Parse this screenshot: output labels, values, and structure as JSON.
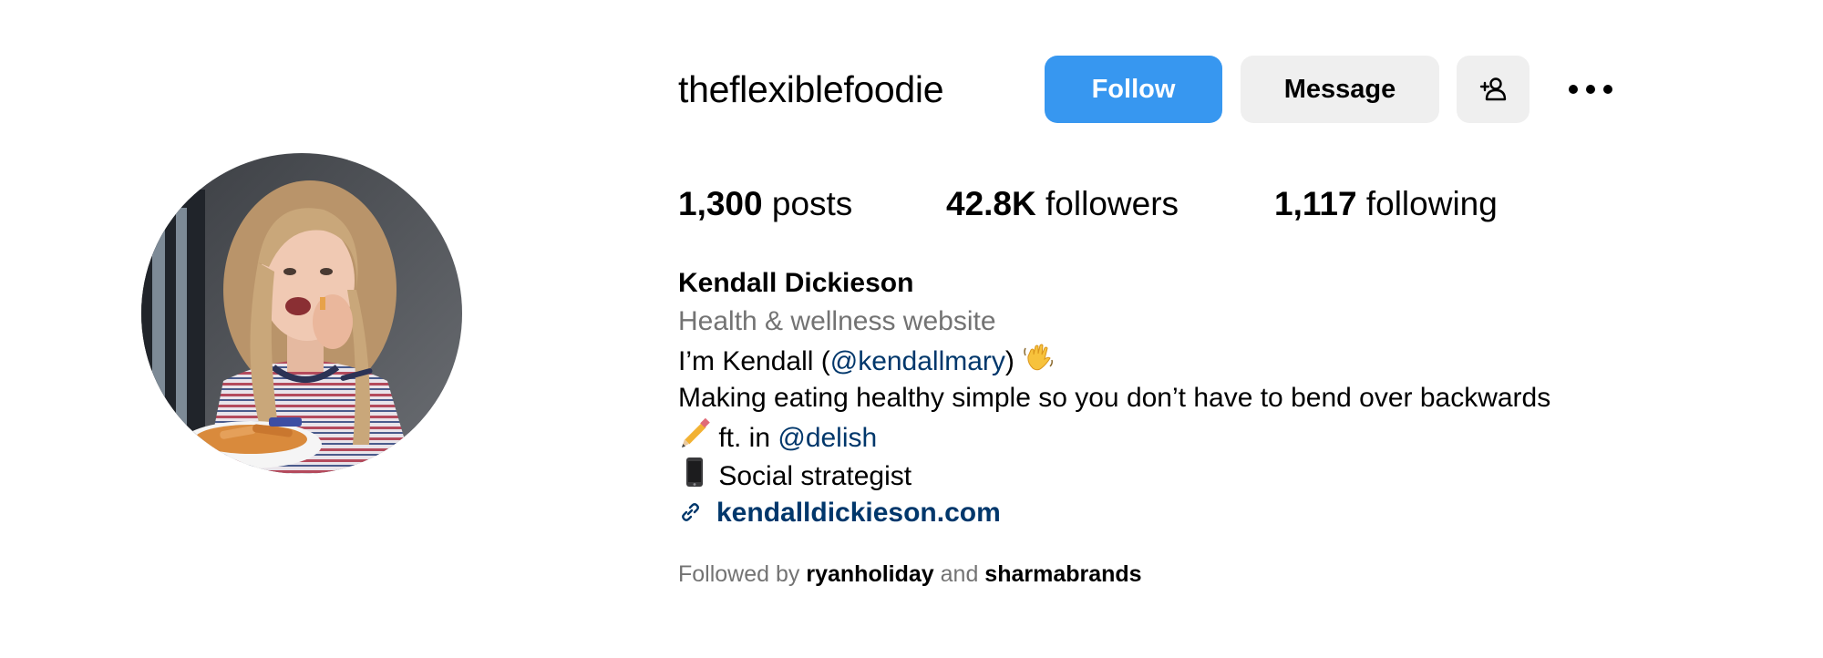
{
  "profile": {
    "username": "theflexiblefoodie",
    "avatar_alt": "profile picture",
    "buttons": {
      "follow": "Follow",
      "message": "Message",
      "suggest_icon": "add-person-icon",
      "more_icon": "more-horizontal-icon"
    },
    "stats": {
      "posts_count": "1,300",
      "posts_label": "posts",
      "followers_count": "42.8K",
      "followers_label": "followers",
      "following_count": "1,117",
      "following_label": "following"
    },
    "bio": {
      "name": "Kendall Dickieson",
      "category": "Health & wellness website",
      "line1_prefix": "I’m Kendall (",
      "line1_mention": "@kendallmary",
      "line1_suffix": ")",
      "line1_emoji": "waving-hand-icon",
      "line2": "Making eating healthy simple so you don’t have to bend over backwards",
      "line3_emoji": "pencil-icon",
      "line3_prefix": " ft. in ",
      "line3_mention": "@delish",
      "line4_emoji": "mobile-phone-icon",
      "line4_text": " Social strategist",
      "link_icon": "link-icon",
      "link_text": "kendalldickieson.com"
    },
    "followed_by": {
      "prefix": "Followed by ",
      "user1": "ryanholiday",
      "conjunction": " and ",
      "user2": "sharmabrands"
    }
  },
  "colors": {
    "follow_button": "#3797f0",
    "secondary_button": "#efefef",
    "link": "#00376b",
    "muted_text": "#737373"
  }
}
